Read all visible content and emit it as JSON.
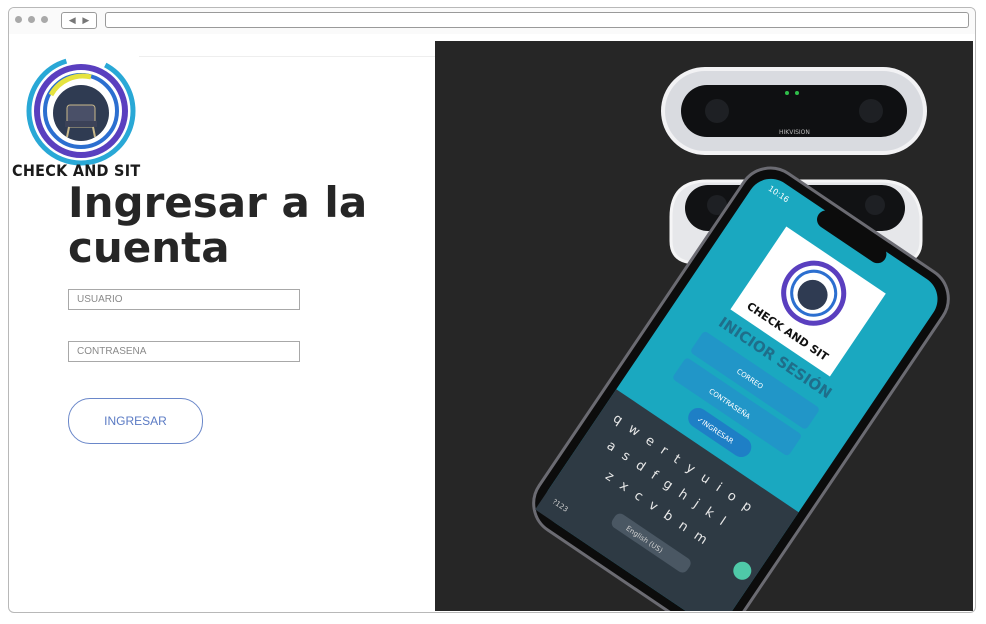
{
  "brand": {
    "name": "CHECK AND SIT"
  },
  "login": {
    "title": "Ingresar a la cuenta",
    "username_placeholder": "USUARIO",
    "password_placeholder": "CONTRASEÑA",
    "submit_label": "INGRESAR"
  },
  "hero": {
    "device_brand": "HIKVISION",
    "phone": {
      "status_time": "10:16",
      "screen_title": "INICIOR SESIÓN",
      "logo_text": "CHECK AND SIT",
      "field_email": "CORREO",
      "field_password": "CONTRASEÑA",
      "button": "✓INGRESAR",
      "keyboard_rows": [
        "q w e r t y u i o p",
        "a s d f g h j k l",
        "z x c v b n m"
      ],
      "space_label": "English (US)",
      "symbols_label": "?123"
    }
  },
  "colors": {
    "hero_bg": "#262626",
    "title": "#262626",
    "button_border": "#6a87c9",
    "button_text": "#5b7bc4",
    "phone_screen": "#1aa8c0"
  }
}
